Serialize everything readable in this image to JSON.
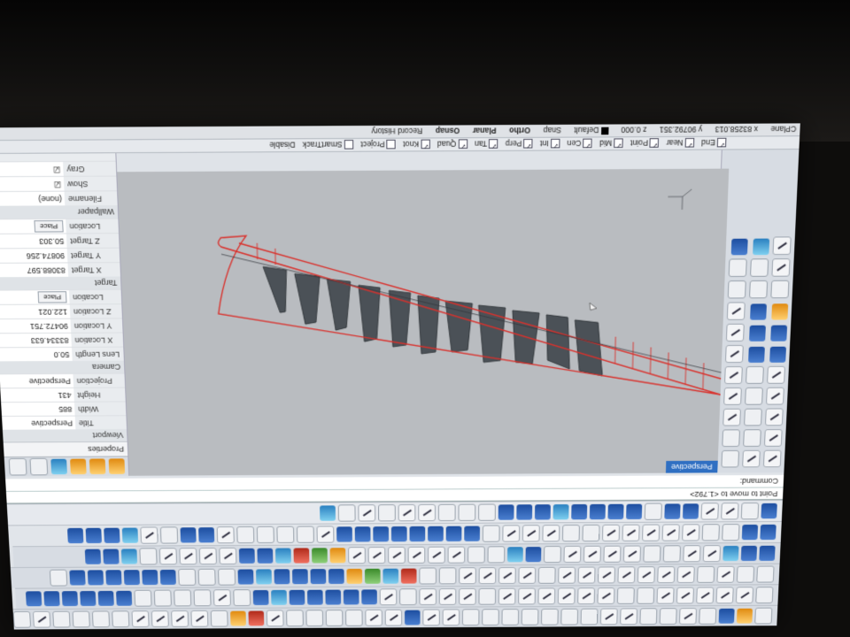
{
  "command": {
    "history": "Point to move to <1.792>",
    "prompt": "Command:"
  },
  "viewport": {
    "tab_label": "Perspective"
  },
  "properties": {
    "title": "Properties",
    "section_viewport": "Viewport",
    "title_label": "Title",
    "title_value": "Perspective",
    "width_label": "Width",
    "width_value": "885",
    "height_label": "Height",
    "height_value": "431",
    "projection_label": "Projection",
    "projection_value": "Perspective",
    "section_camera": "Camera",
    "lens_label": "Lens Length",
    "lens_value": "50.0",
    "xloc_label": "X Location",
    "xloc_value": "83334.633",
    "yloc_label": "Y Location",
    "yloc_value": "90472.751",
    "zloc_label": "Z Location",
    "zloc_value": "122.021",
    "location_label": "Location",
    "location_button": "Place",
    "section_target": "Target",
    "xtarget_label": "X Target",
    "xtarget_value": "83088.597",
    "ytarget_label": "Y Target",
    "ytarget_value": "90874.256",
    "ztarget_label": "Z Target",
    "ztarget_value": "50.303",
    "target_location_label": "Location",
    "target_location_button": "Place",
    "section_wallpaper": "Wallpaper",
    "filename_label": "Filename",
    "filename_value": "(none)",
    "show_label": "Show",
    "gray_label": "Gray"
  },
  "osnap": {
    "items": [
      "End",
      "Near",
      "Point",
      "Mid",
      "Cen",
      "Int",
      "Perp",
      "Tan",
      "Quad",
      "Knot"
    ],
    "project": "Project",
    "smarttrack": "SmartTrack",
    "disable": "Disable"
  },
  "status": {
    "cplane": "CPlane",
    "x": "x 83258.013",
    "y": "y 90792.351",
    "z": "z 0.000",
    "layer": "Default",
    "snap": "Snap",
    "ortho": "Ortho",
    "planar": "Planar",
    "osnap": "Osnap",
    "record_history": "Record History"
  },
  "colors": {
    "accent": "#2f6fc2",
    "curve": "#d9312c",
    "surface": "#4b5157",
    "viewport_bg": "#b9bcc0"
  }
}
